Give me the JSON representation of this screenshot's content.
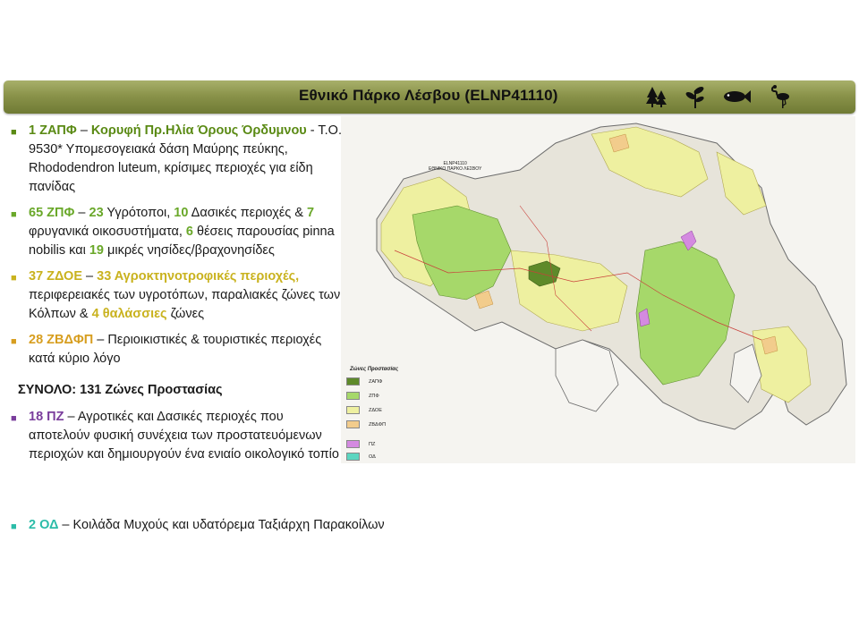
{
  "banner": {
    "title": "Εθνικό Πάρκο Λέσβου (ELNP41110)",
    "icons": [
      "forest-icon",
      "plant-icon",
      "fish-icon",
      "flamingo-icon"
    ]
  },
  "bullets": [
    {
      "color": "#5a8a14",
      "parts": {
        "count": "1 ΖΑΠΦ",
        "dash": " – ",
        "name": "Κορυφή Πρ.Ηλία Όρους Όρδυμνου",
        "rest": " - Τ.Ο. 9530* Υπομεσογειακά δάση Μαύρης πεύκης, Rhododendron luteum, κρίσιμες περιοχές για είδη πανίδας"
      }
    },
    {
      "color": "#6aa82a",
      "parts": {
        "count": "65 ΖΠΦ",
        "dash": " – ",
        "n1": "23",
        "t1": " Υγρότοποι, ",
        "n2": "10",
        "t2": " Δασικές περιοχές & ",
        "n3": "7",
        "t3": " φρυγανικά οικοσυστήματα, ",
        "n4": "6",
        "t4": " θέσεις παρουσίας pinna nobilis και ",
        "n5": "19",
        "t5": " μικρές νησίδες/βραχονησίδες"
      }
    },
    {
      "color": "#c9b21e",
      "parts": {
        "count": "37 ΖΔΟΕ",
        "dash": " –  ",
        "n1": "33 Αγροκτηνοτροφικές περιοχές,",
        "t1": " περιφερειακές των υγροτόπων, παραλιακές ζώνες των Κόλπων & ",
        "n2": "4 θαλάσσιες",
        "t2": " ζώνες"
      }
    },
    {
      "color": "#d79e20",
      "parts": {
        "count": "28 ΖΒΔΦΠ",
        "dash": " – ",
        "rest": "Περιοικιστικές & τουριστικές περιοχές κατά κύριο λόγο"
      }
    }
  ],
  "total": "ΣΥΝΟΛΟ: 131 Ζώνες Προστασίας",
  "pz": {
    "color": "#7a3d9c",
    "count": "18 ΠΖ",
    "dash": " – ",
    "rest": "Αγροτικές και Δασικές περιοχές που αποτελούν φυσική συνέχεια των προστατευόμενων περιοχών και δημιουργούν ένα ενιαίο οικολογικό τοπίο"
  },
  "od": {
    "color": "#2bbca8",
    "count": "2 ΟΔ",
    "dash": " – ",
    "rest": "Κοιλάδα Μυχούς και υδατόρεμα Ταξιάρχη Παρακοίλων"
  },
  "map": {
    "label_code": "ELNP41110",
    "label_name": "ΕΘΝΙΚΟ ΠΑΡΚΟ ΛΕΣΒΟΥ",
    "legend_title": "Ζώνες Προστασίας",
    "legend": [
      {
        "label": "ΖΑΠΦ",
        "color": "#5e8a2a"
      },
      {
        "label": "ΖΠΦ",
        "color": "#a6d86a"
      },
      {
        "label": "ΖΔΟΕ",
        "color": "#eef0a0"
      },
      {
        "label": "ΖΒΔΦΠ",
        "color": "#f2cc8c"
      },
      {
        "label": "ΠΖ",
        "color": "#d48ae0"
      },
      {
        "label": "ΟΔ",
        "color": "#5cd6c0"
      }
    ]
  }
}
